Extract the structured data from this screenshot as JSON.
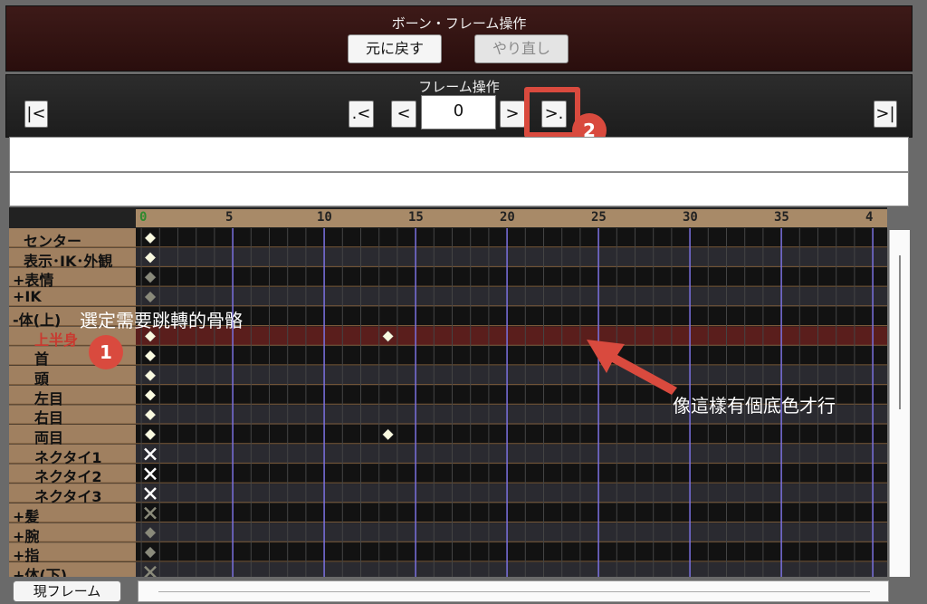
{
  "bone_panel": {
    "title": "ボーン・フレーム操作",
    "undo_label": "元に戻す",
    "redo_label": "やり直し"
  },
  "frame_panel": {
    "title": "フレーム操作",
    "first_label": "|<",
    "prev_key_label": ".<",
    "prev_label": "<",
    "frame_value": "0",
    "next_label": ">",
    "next_key_label": ">.",
    "last_label": ">|"
  },
  "timeline": {
    "ticks": [
      "0",
      "5",
      "10",
      "15",
      "20",
      "25",
      "30",
      "35",
      "4"
    ],
    "bones": [
      {
        "label": "センター",
        "indent": 1,
        "key": "diamond-white",
        "extra": null
      },
      {
        "label": "表示･IK･外観",
        "indent": 1,
        "key": "diamond-white",
        "extra": null
      },
      {
        "label": "+表情",
        "indent": 0,
        "key": "diamond-gray",
        "extra": null
      },
      {
        "label": "+IK",
        "indent": 0,
        "key": "diamond-gray",
        "extra": null
      },
      {
        "label": "-体(上)",
        "indent": 0,
        "key": "none",
        "extra": null
      },
      {
        "label": "上半身",
        "indent": 2,
        "key": "diamond-white",
        "extra": 13,
        "selected": true
      },
      {
        "label": "首",
        "indent": 2,
        "key": "diamond-white",
        "extra": null
      },
      {
        "label": "頭",
        "indent": 2,
        "key": "diamond-white",
        "extra": null
      },
      {
        "label": "左目",
        "indent": 2,
        "key": "diamond-white",
        "extra": null
      },
      {
        "label": "右目",
        "indent": 2,
        "key": "diamond-white",
        "extra": null
      },
      {
        "label": "両目",
        "indent": 2,
        "key": "diamond-white",
        "extra": 13
      },
      {
        "label": "ネクタイ1",
        "indent": 2,
        "key": "x-white",
        "extra": null
      },
      {
        "label": "ネクタイ2",
        "indent": 2,
        "key": "x-white",
        "extra": null
      },
      {
        "label": "ネクタイ3",
        "indent": 2,
        "key": "x-white",
        "extra": null
      },
      {
        "label": "+髪",
        "indent": 0,
        "key": "x-gray",
        "extra": null
      },
      {
        "label": "+腕",
        "indent": 0,
        "key": "diamond-gray",
        "extra": null
      },
      {
        "label": "+指",
        "indent": 0,
        "key": "diamond-gray",
        "extra": null
      },
      {
        "label": "+体(下)",
        "indent": 0,
        "key": "x-gray",
        "extra": null
      }
    ]
  },
  "bottom": {
    "current_frame_label": "現フレーム"
  },
  "annotations": {
    "step1_number": "1",
    "step1_text": "選定需要跳轉的骨骼",
    "step2_number": "2",
    "arrow_text": "像這樣有個底色才行"
  },
  "colors": {
    "accent_red": "#d94a3e",
    "label_tan": "#a08060",
    "selected_row": "#5a1e1c",
    "major_grid": "#7a70e0"
  }
}
